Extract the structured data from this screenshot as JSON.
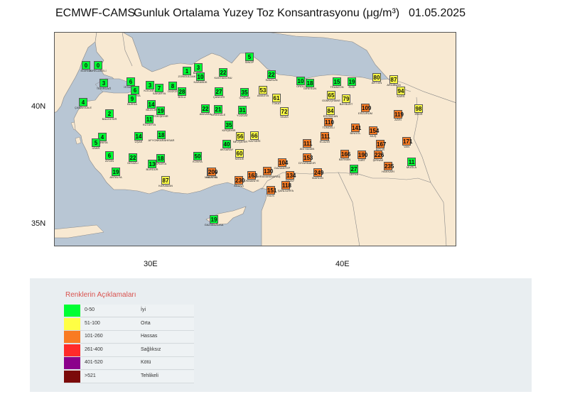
{
  "header": {
    "model": "ECMWF-CAMS",
    "title": "Gunluk Ortalama Yuzey Toz Konsantrasyonu (μg/m³)",
    "date": "01.05.2025"
  },
  "map": {
    "colors": {
      "sea": "#b8c6d4",
      "land": "#f8e9d2",
      "border": "#888888"
    },
    "lat_labels": [
      "40N",
      "35N"
    ],
    "lon_labels": [
      "30E",
      "40E"
    ]
  },
  "categories": [
    {
      "range": "0-50",
      "label": "İyi",
      "color": "#00ff33"
    },
    {
      "range": "51-100",
      "label": "Orta",
      "color": "#ffff44"
    },
    {
      "range": "101-260",
      "label": "Hassas",
      "color": "#f97b22"
    },
    {
      "range": "261-400",
      "label": "Sağlıksız",
      "color": "#ff2a2a"
    },
    {
      "range": "401-520",
      "label": "Kötü",
      "color": "#8b008b"
    },
    {
      "range": ">521",
      "label": "Tehlikeli",
      "color": "#7b0a0a"
    }
  ],
  "legend": {
    "title": "Renklerin Açıklamaları"
  },
  "stations": [
    {
      "name": "EDİRNE",
      "value": 0
    },
    {
      "name": "KIRKLARELİ",
      "value": 0
    },
    {
      "name": "TEKİRDAĞ",
      "value": 3
    },
    {
      "name": "İSTANBUL",
      "value": 6
    },
    {
      "name": "YALOVA",
      "value": 6
    },
    {
      "name": "KOCAELİ",
      "value": 3
    },
    {
      "name": "SAKARYA",
      "value": 7
    },
    {
      "name": "DÜZCE",
      "value": 8
    },
    {
      "name": "BOLU",
      "value": 28
    },
    {
      "name": "ZONGULDAK",
      "value": 1
    },
    {
      "name": "BARTIN",
      "value": 3
    },
    {
      "name": "KARABÜK",
      "value": 10
    },
    {
      "name": "KASTAMONU",
      "value": 22
    },
    {
      "name": "SİNOP",
      "value": 5
    },
    {
      "name": "SAMSUN",
      "value": 22
    },
    {
      "name": "ORDU",
      "value": 10
    },
    {
      "name": "GİRESUN",
      "value": 18
    },
    {
      "name": "TRABZON",
      "value": 15
    },
    {
      "name": "RİZE",
      "value": 19
    },
    {
      "name": "ARTVİN",
      "value": 80
    },
    {
      "name": "ARDAHAN",
      "value": 87
    },
    {
      "name": "KARS",
      "value": 94
    },
    {
      "name": "IĞDIR",
      "value": 98
    },
    {
      "name": "ÇANAKKALE",
      "value": 4
    },
    {
      "name": "BURSA",
      "value": 9
    },
    {
      "name": "BİLECİK",
      "value": 14
    },
    {
      "name": "ESKİŞEHİR",
      "value": 19
    },
    {
      "name": "BALIKESİR",
      "value": 2
    },
    {
      "name": "ANKARA",
      "value": 22
    },
    {
      "name": "KIRIKKALE",
      "value": 21
    },
    {
      "name": "ÇANKIRI",
      "value": 27
    },
    {
      "name": "ÇORUM",
      "value": 35
    },
    {
      "name": "YOZGAT",
      "value": 31
    },
    {
      "name": "AMASYA",
      "value": 53
    },
    {
      "name": "TOKAT",
      "value": 61
    },
    {
      "name": "SİVAS",
      "value": 72
    },
    {
      "name": "GÜMÜŞHANE",
      "value": 65
    },
    {
      "name": "BAYBURT",
      "value": 79
    },
    {
      "name": "ERZİNCAN",
      "value": 84
    },
    {
      "name": "ERZURUM",
      "value": 109
    },
    {
      "name": "AĞRI",
      "value": 119
    },
    {
      "name": "TUNCELİ",
      "value": 110
    },
    {
      "name": "KÜTAHYA",
      "value": 11
    },
    {
      "name": "MANİSA",
      "value": 4
    },
    {
      "name": "İZMİR",
      "value": 5
    },
    {
      "name": "UŞAK",
      "value": 14
    },
    {
      "name": "AFYONKARAHİSAR",
      "value": 18
    },
    {
      "name": "KIRŞEHİR",
      "value": 35
    },
    {
      "name": "NEVŞEHİR",
      "value": 56
    },
    {
      "name": "KAYSERİ",
      "value": 66
    },
    {
      "name": "AKSARAY",
      "value": 40
    },
    {
      "name": "NİĞDE",
      "value": 60
    },
    {
      "name": "ELAZIĞ",
      "value": 111
    },
    {
      "name": "BİNGÖL",
      "value": 141
    },
    {
      "name": "MUŞ",
      "value": 154
    },
    {
      "name": "BİTLİS",
      "value": 167
    },
    {
      "name": "VAN",
      "value": 171
    },
    {
      "name": "AYDIN",
      "value": 6
    },
    {
      "name": "DENİZLİ",
      "value": 22
    },
    {
      "name": "BURDUR",
      "value": 13
    },
    {
      "name": "ISPARTA",
      "value": 18
    },
    {
      "name": "KONYA",
      "value": 50
    },
    {
      "name": "MALATYA",
      "value": 115
    },
    {
      "name": "ADIYAMAN",
      "value": 111
    },
    {
      "name": "DİYARBAKIR",
      "value": 153
    },
    {
      "name": "BATMAN",
      "value": 166
    },
    {
      "name": "SİİRT",
      "value": 190
    },
    {
      "name": "ŞIRNAK",
      "value": 226
    },
    {
      "name": "HAKKARİ",
      "value": 235
    },
    {
      "name": "MUĞLA",
      "value": 11
    },
    {
      "name": "ANTALYA",
      "value": 19
    },
    {
      "name": "KARAMAN",
      "value": 87
    },
    {
      "name": "MERSİN",
      "value": 200
    },
    {
      "name": "ADANA",
      "value": 230
    },
    {
      "name": "OSMANİYE",
      "value": 163
    },
    {
      "name": "KAHRAMANMARAŞ",
      "value": 130
    },
    {
      "name": "GAZİANTEP",
      "value": 104
    },
    {
      "name": "HATAY",
      "value": 134
    },
    {
      "name": "KİLİS",
      "value": 151
    },
    {
      "name": "ŞANLIURFA",
      "value": 118
    },
    {
      "name": "MARDİN",
      "value": 249
    },
    {
      "name": "LEFKE",
      "value": 27
    },
    {
      "name": "GAZİMAĞUSA",
      "value": 19
    }
  ]
}
